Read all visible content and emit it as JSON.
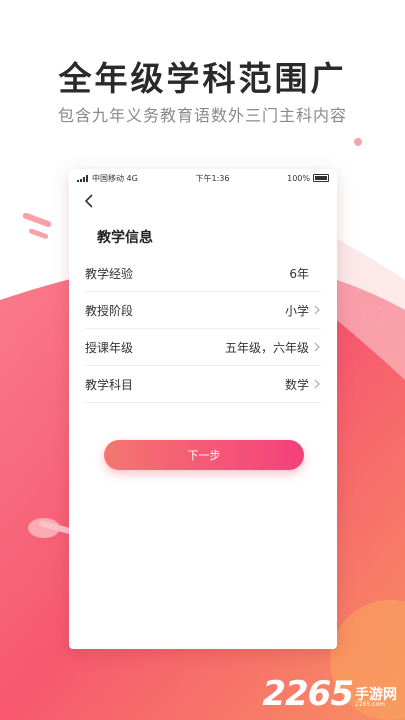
{
  "promo": {
    "headline": "全年级学科范围广",
    "subheadline": "包含九年义务教育语数外三门主科内容"
  },
  "status_bar": {
    "carrier": "中国移动 4G",
    "time": "下午1:36",
    "battery": "100%"
  },
  "screen": {
    "section_title": "教学信息",
    "rows": [
      {
        "label": "教学经验",
        "value": "6年"
      },
      {
        "label": "教授阶段",
        "value": "小学"
      },
      {
        "label": "授课年级",
        "value": "五年级，六年级"
      },
      {
        "label": "教学科目",
        "value": "数学"
      }
    ],
    "next_button": "下一步"
  },
  "watermark": {
    "number": "2265",
    "text": "手游网",
    "url": "2265.com"
  },
  "colors": {
    "accent_start": "#f47670",
    "accent_end": "#f53f7c",
    "background_gradient": "#f8607b"
  }
}
